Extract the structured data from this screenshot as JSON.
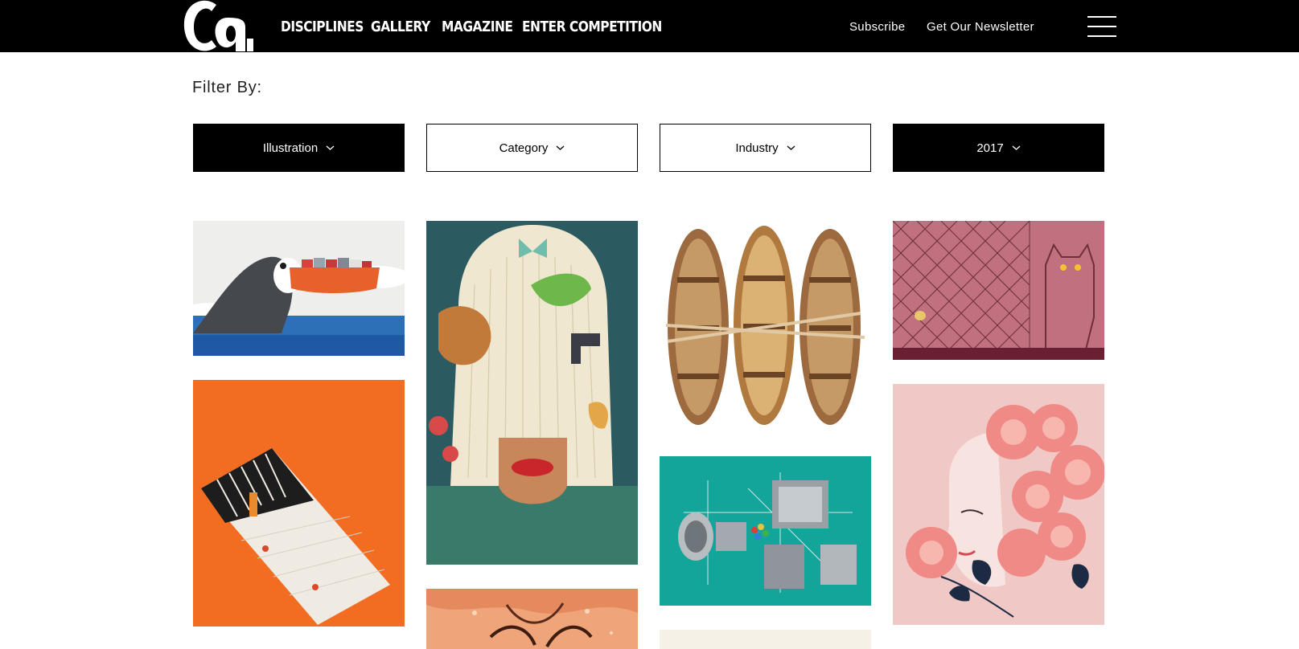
{
  "header": {
    "logo_text": "CA",
    "nav": [
      "DISCIPLINES",
      "GALLERY",
      "MAGAZINE",
      "ENTER COMPETITION"
    ],
    "subscribe": "Subscribe",
    "newsletter": "Get Our Newsletter",
    "menu_icon": "hamburger-menu-icon"
  },
  "filter": {
    "label": "Filter By:",
    "discipline": "Illustration",
    "category": "Category",
    "industry": "Industry",
    "year": "2017"
  },
  "gallery": {
    "items": [
      {
        "id": "toucan-cargo-ship",
        "icon": "illustration-toucan-ship"
      },
      {
        "id": "wig-face-animals",
        "icon": "illustration-wig-portrait"
      },
      {
        "id": "three-rowboats",
        "icon": "illustration-rowboats"
      },
      {
        "id": "cat-fence-pink",
        "icon": "illustration-cat-fence"
      },
      {
        "id": "orange-prison-stairs",
        "icon": "illustration-prison-stairs"
      },
      {
        "id": "exploded-camera",
        "icon": "illustration-exploded-camera"
      },
      {
        "id": "rose-woman-profile",
        "icon": "illustration-rose-woman"
      },
      {
        "id": "face-closeup-partial",
        "icon": "illustration-face-closeup"
      },
      {
        "id": "cream-partial",
        "icon": "illustration-partial"
      }
    ]
  },
  "colors": {
    "header_bg": "#000000",
    "orange": "#f26d22",
    "teal": "#13a59a",
    "pink_mauve": "#c0707e",
    "blush": "#f0c8c6"
  }
}
